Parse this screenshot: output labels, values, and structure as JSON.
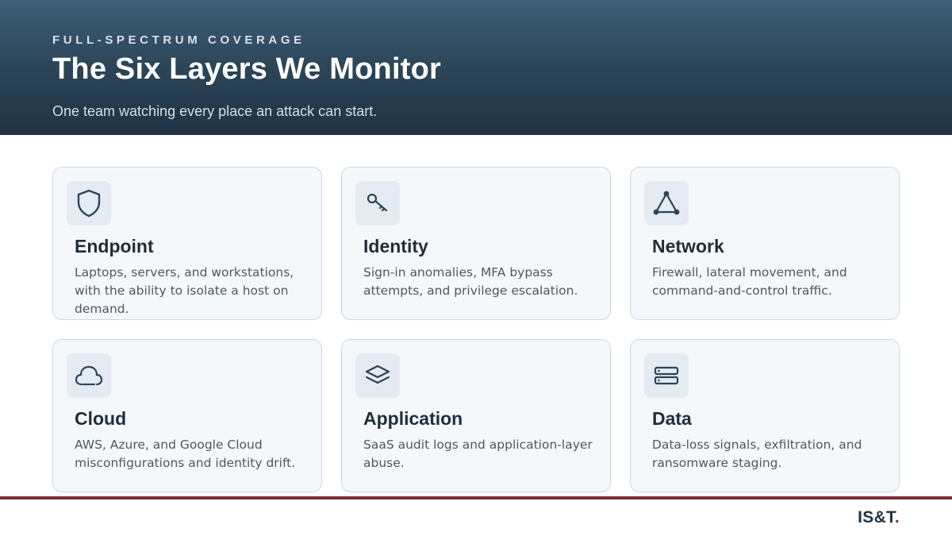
{
  "header": {
    "eyebrow": "FULL-SPECTRUM COVERAGE",
    "title": "The Six Layers We Monitor",
    "subtitle": "One team watching every place an attack can start."
  },
  "cards": [
    {
      "icon": "shield-icon",
      "title": "Endpoint",
      "description": "Laptops, servers, and workstations, with the ability to isolate a host on demand."
    },
    {
      "icon": "key-icon",
      "title": "Identity",
      "description": "Sign-in anomalies, MFA bypass attempts, and privilege escalation."
    },
    {
      "icon": "network-nodes-icon",
      "title": "Network",
      "description": "Firewall, lateral movement, and command-and-control traffic."
    },
    {
      "icon": "cloud-icon",
      "title": "Cloud",
      "description": "AWS, Azure, and Google Cloud misconfigurations and identity drift."
    },
    {
      "icon": "layers-icon",
      "title": "Application",
      "description": "SaaS audit logs and application-layer abuse."
    },
    {
      "icon": "server-icon",
      "title": "Data",
      "description": "Data-loss signals, exfiltration, and ransomware staging."
    }
  ],
  "footer": {
    "logo_text": "IS&T",
    "logo_dot": "."
  },
  "colors": {
    "accent_rule": "#7b2c35",
    "icon_stroke": "#2c4558"
  }
}
